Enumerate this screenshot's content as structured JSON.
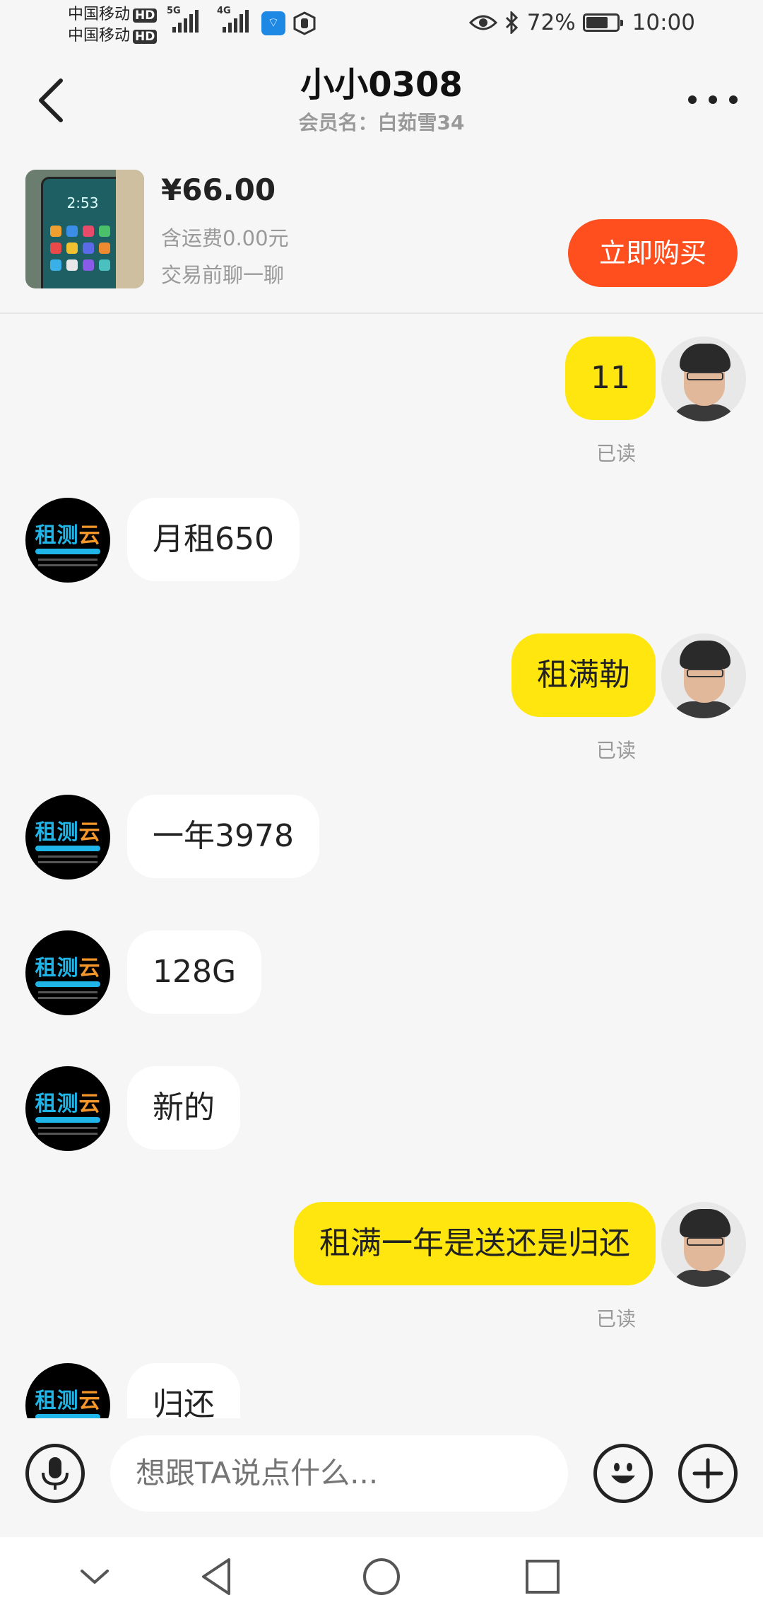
{
  "status_bar": {
    "carrier1": "中国移动",
    "carrier2": "中国移动",
    "hd": "HD",
    "net1": "5G",
    "net2": "4G",
    "battery": "72%",
    "battery_level": 0.72,
    "time": "10:00"
  },
  "header": {
    "title": "小小0308",
    "subtitle": "会员名：白茹雪34"
  },
  "product": {
    "price": "¥66.00",
    "shipping": "含运费0.00元",
    "note": "交易前聊一聊",
    "buy_label": "立即购买"
  },
  "messages": [
    {
      "side": "out",
      "text": "11",
      "status": "已读"
    },
    {
      "side": "in",
      "text": "月租650"
    },
    {
      "side": "out",
      "text": "租满勒",
      "status": "已读"
    },
    {
      "side": "in",
      "text": "一年3978"
    },
    {
      "side": "in",
      "text": "128G"
    },
    {
      "side": "in",
      "text": "新的"
    },
    {
      "side": "out",
      "text": "租满一年是送还是归还",
      "status": "已读"
    },
    {
      "side": "in",
      "text": "归还"
    }
  ],
  "avatar_them_logo": {
    "part1": "租测",
    "part2": "云"
  },
  "input": {
    "placeholder": "想跟TA说点什么..."
  },
  "colors": {
    "accent_buy": "#ff4f1f",
    "outgoing_bubble": "#ffe60f",
    "incoming_bubble": "#ffffff",
    "background": "#f6f6f6"
  },
  "icons": {
    "back": "chevron-left-icon",
    "more": "more-dots-icon",
    "voice": "microphone-icon",
    "emoji": "emoji-icon",
    "plus": "plus-icon",
    "nav": [
      "collapse-icon",
      "nav-back-icon",
      "nav-home-icon",
      "nav-recents-icon"
    ]
  }
}
